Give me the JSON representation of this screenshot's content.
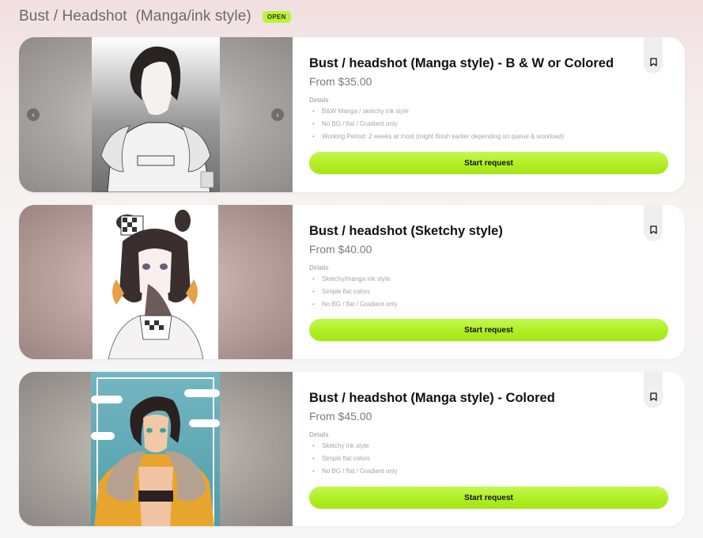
{
  "header": {
    "title": "Bust / Headshot  (Manga/ink style)",
    "badge": "OPEN"
  },
  "cards": [
    {
      "title": "Bust / headshot (Manga style) - B & W or Colored",
      "price": "From $35.00",
      "details_label": "Details",
      "details": [
        "B&W Manga / sketchy ink style",
        "No BG / flat / Gradient only",
        "Working Period: 2 weeks at most (might finish earlier depending on queue & workload)"
      ],
      "button": "Start request",
      "carousel_prev": "‹",
      "carousel_next": "›",
      "icon": "bookmark-icon"
    },
    {
      "title": "Bust / headshot (Sketchy style)",
      "price": "From $40.00",
      "details_label": "Details",
      "details": [
        "Sketchy/manga ink style",
        "Simple flat colors",
        "No BG / flat / Gradient only"
      ],
      "button": "Start request",
      "icon": "bookmark-icon"
    },
    {
      "title": "Bust / headshot (Manga style) - Colored",
      "price": "From $45.00",
      "details_label": "Details",
      "details": [
        "Sketchy ink style",
        "Simple flat colors",
        "No BG / flat / Gradient only"
      ],
      "button": "Start request",
      "icon": "bookmark-icon"
    }
  ],
  "colors": {
    "accent": "#b0ee24",
    "badge": "#b9f23b",
    "card": "#ffffff",
    "page_top": "#f2dfe0"
  }
}
